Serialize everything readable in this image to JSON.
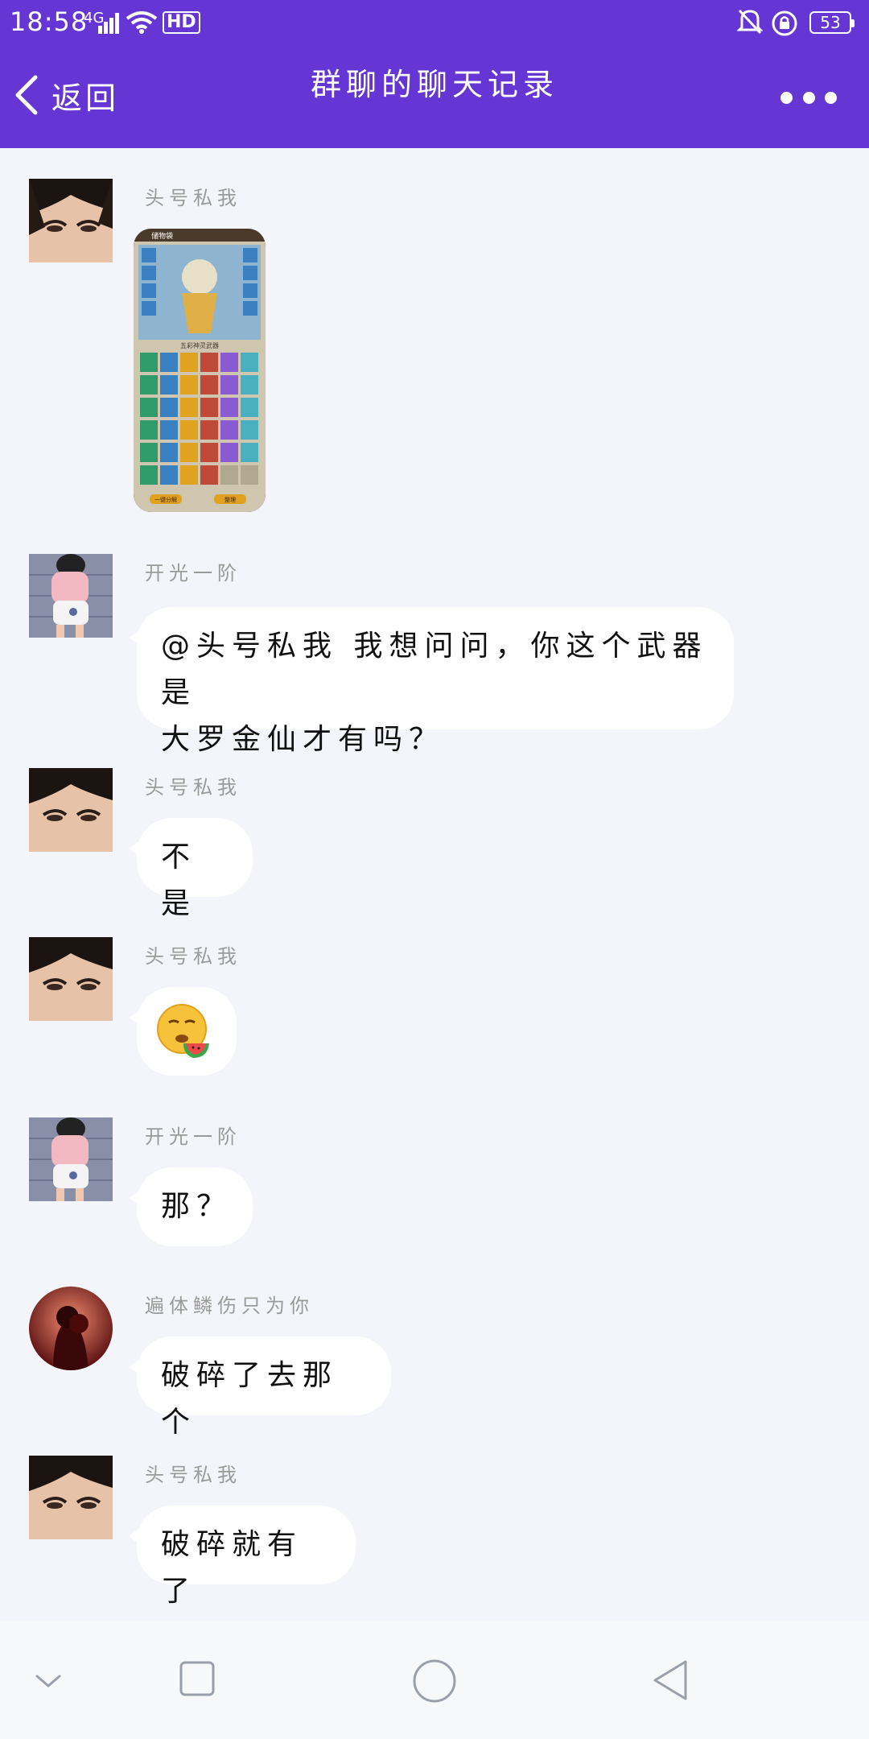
{
  "status_bar": {
    "time": "18:58",
    "network": "4G",
    "hd": "HD",
    "battery": "53"
  },
  "header": {
    "back_label": "返回",
    "title": "群聊的聊天记录",
    "more_icon": "more-dots-icon",
    "bg_color": "#6536d4"
  },
  "messages": [
    {
      "sender": "头号私我",
      "type": "image",
      "avatar": "girl-face-avatar"
    },
    {
      "sender": "开光一阶",
      "type": "text",
      "avatar": "cartoon-kid-avatar",
      "lines": [
        "@头号私我 我想问问，你这个武器是",
        "大罗金仙才有吗？"
      ]
    },
    {
      "sender": "头号私我",
      "type": "text",
      "avatar": "girl-face-avatar",
      "lines": [
        "不是"
      ]
    },
    {
      "sender": "头号私我",
      "type": "emoji",
      "avatar": "girl-face-avatar",
      "emoji": "watermelon-emoji"
    },
    {
      "sender": "开光一阶",
      "type": "text",
      "avatar": "cartoon-kid-avatar",
      "lines": [
        "那？"
      ]
    },
    {
      "sender": "遍体鳞伤只为你",
      "type": "text",
      "avatar": "couple-red-avatar",
      "lines": [
        "破碎了去那个"
      ]
    },
    {
      "sender": "头号私我",
      "type": "text",
      "avatar": "girl-face-avatar",
      "lines": [
        "破碎就有了"
      ]
    }
  ],
  "image_message": {
    "game_title": "储物袋",
    "caption": "五彩神灵武器",
    "button_left": "一键分解",
    "button_right": "整理"
  },
  "nav_icons": [
    "collapse-chevron-icon",
    "recent-apps-icon",
    "home-icon",
    "back-triangle-icon"
  ]
}
